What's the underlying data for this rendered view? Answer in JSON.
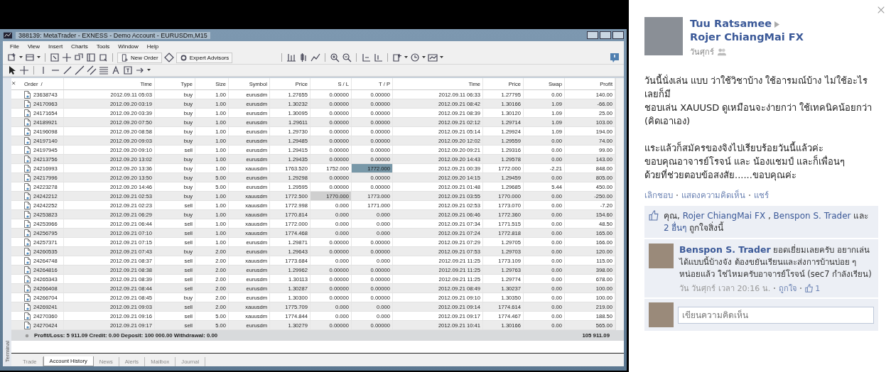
{
  "window": {
    "title": "388139: MetaTrader - EXNESS - Demo Account - EURUSDm,M15"
  },
  "menu": [
    "File",
    "View",
    "Insert",
    "Charts",
    "Tools",
    "Window",
    "Help"
  ],
  "toolbar": {
    "buttons": [
      "New Order",
      "Expert Advisors"
    ]
  },
  "terminal": {
    "side_label": "Terminal",
    "table": {
      "columns": [
        "Order",
        "Time",
        "Type",
        "Size",
        "Symbol",
        "Price",
        "S / L",
        "T / P",
        "Time",
        "Price",
        "Swap",
        "Profit"
      ],
      "sort_indicator": "/",
      "rows": [
        {
          "cells": [
            "23638743",
            "2012.09.11 05:03",
            "buy",
            "1.00",
            "eurusdm",
            "1.27655",
            "0.00000",
            "0.00000",
            "2012.09.11 06:33",
            "1.27795",
            "0.00",
            "140.00"
          ]
        },
        {
          "cells": [
            "24170963",
            "2012.09.20 03:19",
            "buy",
            "1.00",
            "eurusdm",
            "1.30232",
            "0.00000",
            "0.00000",
            "2012.09.21 08:42",
            "1.30166",
            "1.09",
            "-66.00"
          ]
        },
        {
          "cells": [
            "24171654",
            "2012.09.20 03:39",
            "buy",
            "1.00",
            "eurusdm",
            "1.30095",
            "0.00000",
            "0.00000",
            "2012.09.21 08:39",
            "1.30120",
            "1.09",
            "25.00"
          ]
        },
        {
          "cells": [
            "24189921",
            "2012.09.20 07:50",
            "buy",
            "1.00",
            "eurusdm",
            "1.29611",
            "0.00000",
            "0.00000",
            "2012.09.21 02:12",
            "1.29714",
            "1.09",
            "103.00"
          ]
        },
        {
          "cells": [
            "24196098",
            "2012.09.20 08:58",
            "buy",
            "1.00",
            "eurusdm",
            "1.29730",
            "0.00000",
            "0.00000",
            "2012.09.21 05:14",
            "1.29924",
            "1.09",
            "194.00"
          ]
        },
        {
          "cells": [
            "24197140",
            "2012.09.20 09:03",
            "buy",
            "1.00",
            "eurusdm",
            "1.29485",
            "0.00000",
            "0.00000",
            "2012.09.20 12:02",
            "1.29559",
            "0.00",
            "74.00"
          ]
        },
        {
          "cells": [
            "24197945",
            "2012.09.20 09:10",
            "sell",
            "1.00",
            "eurusdm",
            "1.29415",
            "0.00000",
            "0.00000",
            "2012.09.20 09:21",
            "1.29316",
            "0.00",
            "99.00"
          ]
        },
        {
          "cells": [
            "24213756",
            "2012.09.20 13:02",
            "buy",
            "1.00",
            "eurusdm",
            "1.29435",
            "0.00000",
            "0.00000",
            "2012.09.20 14:43",
            "1.29578",
            "0.00",
            "143.00"
          ]
        },
        {
          "cells": [
            "24216993",
            "2012.09.20 13:36",
            "buy",
            "1.00",
            "xauusdm",
            "1763.520",
            "1752.000",
            "1772.000",
            "2012.09.21 00:39",
            "1772.000",
            "-2.21",
            "848.00"
          ],
          "kind": "selected_take_profit"
        },
        {
          "cells": [
            "24217996",
            "2012.09.20 13:50",
            "buy",
            "5.00",
            "eurusdm",
            "1.29298",
            "0.00000",
            "0.00000",
            "2012.09.20 14:15",
            "1.29459",
            "0.00",
            "805.00"
          ]
        },
        {
          "cells": [
            "24223278",
            "2012.09.20 14:46",
            "buy",
            "5.00",
            "eurusdm",
            "1.29595",
            "0.00000",
            "0.00000",
            "2012.09.21 01:48",
            "1.29685",
            "5.44",
            "450.00"
          ]
        },
        {
          "cells": [
            "24242212",
            "2012.09.21 02:53",
            "buy",
            "1.00",
            "xauusdm",
            "1772.500",
            "1770.000",
            "1773.000",
            "2012.09.21 03:55",
            "1770.000",
            "0.00",
            "-250.00"
          ],
          "kind": "hovered_stop_loss"
        },
        {
          "cells": [
            "24242252",
            "2012.09.21 02:23",
            "sell",
            "1.00",
            "xauusdm",
            "1772.998",
            "0.000",
            "1771.000",
            "2012.09.21 02:53",
            "1773.070",
            "0.00",
            "-7.20"
          ]
        },
        {
          "cells": [
            "24253823",
            "2012.09.21 06:29",
            "buy",
            "1.00",
            "xauusdm",
            "1770.814",
            "0.000",
            "0.000",
            "2012.09.21 06:46",
            "1772.360",
            "0.00",
            "154.60"
          ]
        },
        {
          "cells": [
            "24253966",
            "2012.09.21 06:44",
            "sell",
            "1.00",
            "xauusdm",
            "1772.000",
            "0.000",
            "0.000",
            "2012.09.21 07:34",
            "1771.515",
            "0.00",
            "48.50"
          ]
        },
        {
          "cells": [
            "24256795",
            "2012.09.21 07:10",
            "sell",
            "1.00",
            "xauusdm",
            "1774.468",
            "0.000",
            "0.000",
            "2012.09.21 07:24",
            "1772.818",
            "0.00",
            "165.00"
          ]
        },
        {
          "cells": [
            "24257371",
            "2012.09.21 07:15",
            "sell",
            "1.00",
            "eurusdm",
            "1.29871",
            "0.00000",
            "0.00000",
            "2012.09.21 07:29",
            "1.29705",
            "0.00",
            "166.00"
          ]
        },
        {
          "cells": [
            "24260535",
            "2012.09.21 07:43",
            "buy",
            "2.00",
            "eurusdm",
            "1.29643",
            "0.00000",
            "0.00000",
            "2012.09.21 07:53",
            "1.29703",
            "0.00",
            "120.00"
          ]
        },
        {
          "cells": [
            "24264748",
            "2012.09.21 08:37",
            "sell",
            "2.00",
            "xauusdm",
            "1773.684",
            "0.000",
            "0.000",
            "2012.09.21 11:25",
            "1773.109",
            "0.00",
            "115.00"
          ]
        },
        {
          "cells": [
            "24264816",
            "2012.09.21 08:38",
            "sell",
            "2.00",
            "eurusdm",
            "1.29962",
            "0.00000",
            "0.00000",
            "2012.09.21 11:25",
            "1.29763",
            "0.00",
            "398.00"
          ]
        },
        {
          "cells": [
            "24265343",
            "2012.09.21 08:39",
            "sell",
            "2.00",
            "eurusdm",
            "1.30113",
            "0.00000",
            "0.00000",
            "2012.09.21 11:25",
            "1.29774",
            "0.00",
            "678.00"
          ]
        },
        {
          "cells": [
            "24266408",
            "2012.09.21 08:44",
            "sell",
            "2.00",
            "eurusdm",
            "1.30287",
            "0.00000",
            "0.00000",
            "2012.09.21 08:49",
            "1.30237",
            "0.00",
            "100.00"
          ]
        },
        {
          "cells": [
            "24266704",
            "2012.09.21 08:45",
            "buy",
            "2.00",
            "eurusdm",
            "1.30300",
            "0.00000",
            "0.00000",
            "2012.09.21 09:10",
            "1.30350",
            "0.00",
            "100.00"
          ]
        },
        {
          "cells": [
            "24269241",
            "2012.09.21 09:03",
            "sell",
            "2.00",
            "xauusdm",
            "1775.709",
            "0.000",
            "0.000",
            "2012.09.21 09:14",
            "1774.614",
            "0.00",
            "219.00"
          ]
        },
        {
          "cells": [
            "24270360",
            "2012.09.21 09:16",
            "sell",
            "5.00",
            "xauusdm",
            "1774.844",
            "0.000",
            "0.000",
            "2012.09.21 09:17",
            "1774.467",
            "0.00",
            "188.50"
          ]
        },
        {
          "cells": [
            "24270424",
            "2012.09.21 09:17",
            "sell",
            "5.00",
            "eurusdm",
            "1.30279",
            "0.00000",
            "0.00000",
            "2012.09.21 10:41",
            "1.30166",
            "0.00",
            "565.00"
          ]
        }
      ]
    },
    "summary": {
      "text": "Profit/Loss: 5 911.09  Credit: 0.00  Deposit: 100 000.00  Withdrawal: 0.00",
      "total": "105 911.09"
    },
    "tabs": [
      {
        "label": "Trade",
        "selected": false
      },
      {
        "label": "Account History",
        "selected": true
      },
      {
        "label": "News",
        "selected": false
      },
      {
        "label": "Alerts",
        "selected": false
      },
      {
        "label": "Mailbox",
        "selected": false
      },
      {
        "label": "Journal",
        "selected": false
      }
    ]
  },
  "post": {
    "author": "Tuu Ratsamee",
    "target": "Rojer ChiangMai FX",
    "date": "วันศุกร์",
    "paragraphs": [
      [
        "วันนี้นั่งเล่น แบบ ว่าใช้วิชาบ้าง ใช้อารมณ์บ้าง ไม่ใช้อะไรเลยก็มี",
        "ชอบเล่น XAUUSD ดูเหมือนจะง่ายกว่า ใช้เทคนิคน้อยกว่า (คิดเอาเอง)"
      ],
      [
        "แระแล้วก็สมัครของจิงไปเรียบร้อยวันนี้แล้วค่ะ",
        "ขอบคุณอาจารย์โรจน์ และ น้องแชมป์ และก็เพื่อนๆ",
        "ด้วยที่ช่วยตอบข้อสงสัย......ขอบคุณค่ะ"
      ]
    ],
    "actions": [
      "เลิกชอบ",
      "แสดงความคิดเห็น",
      "แชร์"
    ],
    "likes": [
      {
        "kind": "plain",
        "text": "คุณ, "
      },
      {
        "kind": "link",
        "text": "Rojer ChiangMai FX"
      },
      {
        "kind": "plain",
        "text": " , "
      },
      {
        "kind": "link",
        "text": "Benspon S. Trader"
      },
      {
        "kind": "plain",
        "text": " และ "
      },
      {
        "kind": "link",
        "text": "2 อื่นๆ"
      },
      {
        "kind": "plain",
        "text": " ถูกใจสิ่งนี้"
      }
    ],
    "comment": {
      "author": "Benspon S. Trader",
      "text": "ยอดเยี่ยมเลยครับ อยากเล่นได้แบบนี้บ้างจัง ต้องขยันเรียนและส่งการบ้านบ่อย ๆ หน่อยแล้ว ใช่ไหมครับอาจารย์โรจน์ (sec7 กำลังเรียน)",
      "time": "วัน วันศุกร์ เวลา 20:16 น.",
      "like_link": "ถูกใจ",
      "like_count": "1"
    },
    "comment_box": {
      "placeholder": "เขียนความคิดเห็น"
    }
  }
}
